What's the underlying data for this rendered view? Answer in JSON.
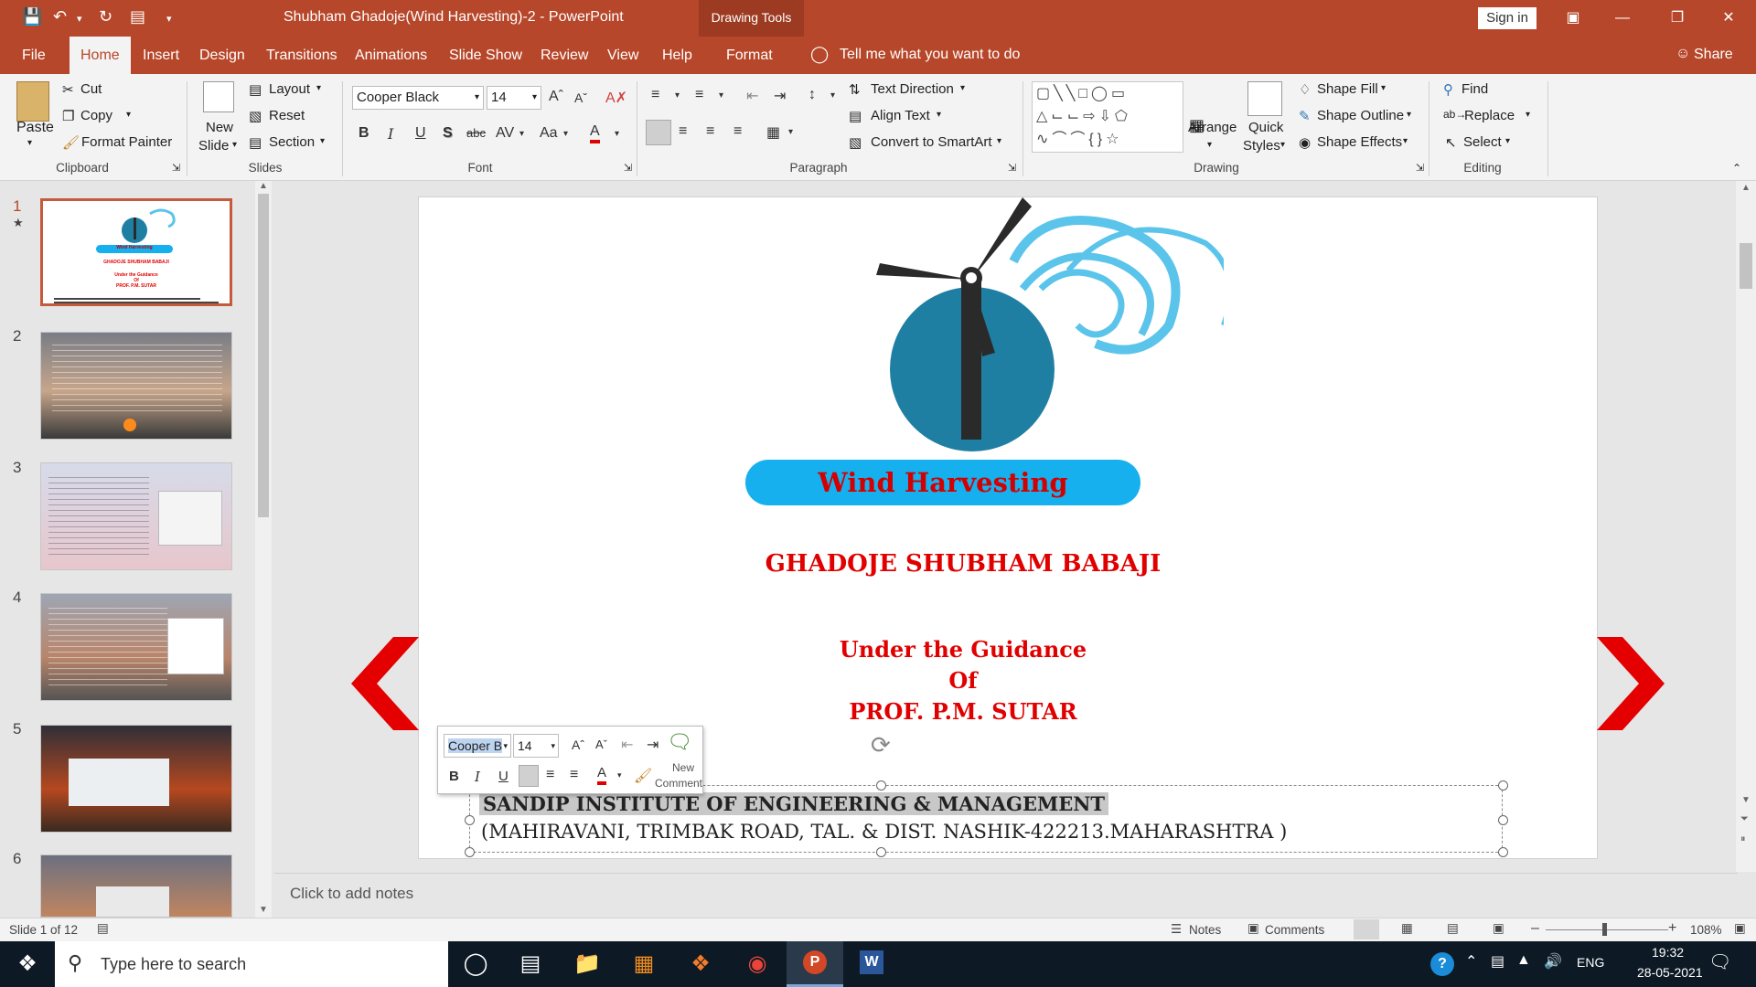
{
  "title_bar": {
    "document_title": "Shubham Ghadoje(Wind Harvesting)-2  -  PowerPoint",
    "context_tab": "Drawing Tools",
    "sign_in": "Sign in"
  },
  "tabs": [
    "File",
    "Home",
    "Insert",
    "Design",
    "Transitions",
    "Animations",
    "Slide Show",
    "Review",
    "View",
    "Help",
    "Format"
  ],
  "tell_me": "Tell me what you want to do",
  "share": "Share",
  "ribbon": {
    "clipboard": {
      "paste": "Paste",
      "cut": "Cut",
      "copy": "Copy",
      "format_painter": "Format Painter",
      "group": "Clipboard"
    },
    "slides": {
      "new_slide_1": "New",
      "new_slide_2": "Slide",
      "layout": "Layout",
      "reset": "Reset",
      "section": "Section",
      "group": "Slides"
    },
    "font": {
      "name": "Cooper Black",
      "size": "14",
      "group": "Font"
    },
    "paragraph": {
      "text_direction": "Text Direction",
      "align_text": "Align Text",
      "smartart": "Convert to SmartArt",
      "group": "Paragraph"
    },
    "drawing": {
      "arrange": "Arrange",
      "quick_styles_1": "Quick",
      "quick_styles_2": "Styles",
      "shape_fill": "Shape Fill",
      "shape_outline": "Shape Outline",
      "shape_effects": "Shape Effects",
      "group": "Drawing"
    },
    "editing": {
      "find": "Find",
      "replace": "Replace",
      "select": "Select",
      "group": "Editing"
    }
  },
  "thumbnails": [
    {
      "num": "1",
      "mini_title": "Wind Harvesting",
      "mini_name": "GHADOJE SHUBHAM BABAJI",
      "mini_guide": "Under the Guidance",
      "mini_of": "Of",
      "mini_prof": "PROF. P.M. SUTAR"
    },
    {
      "num": "2"
    },
    {
      "num": "3"
    },
    {
      "num": "4"
    },
    {
      "num": "5"
    },
    {
      "num": "6"
    }
  ],
  "slide": {
    "banner": "Wind Harvesting",
    "author": "GHADOJE SHUBHAM BABAJI",
    "guidance": "Under the Guidance",
    "of": "Of",
    "prof": "PROF. P.M. SUTAR",
    "institute": "SANDIP INSTITUTE OF ENGINEERING & MANAGEMENT",
    "address": "(MAHIRAVANI, TRIMBAK ROAD, TAL. & DIST. NASHIK-422213.MAHARASHTRA )"
  },
  "mini_toolbar": {
    "font": "Cooper B",
    "size": "14",
    "new_comment_1": "New",
    "new_comment_2": "Comment"
  },
  "notes_placeholder": "Click to add notes",
  "status": {
    "slide": "Slide 1 of 12",
    "notes": "Notes",
    "comments": "Comments",
    "zoom": "108%"
  },
  "taskbar": {
    "search": "Type here to search",
    "lang": "ENG",
    "time": "19:32",
    "date": "28-05-2021"
  },
  "colors": {
    "accent": "#b7472a",
    "slide_red": "#e10000",
    "banner_blue": "#16b0ee",
    "turbine": "#2a2a2a",
    "globe": "#1f7fa3"
  }
}
